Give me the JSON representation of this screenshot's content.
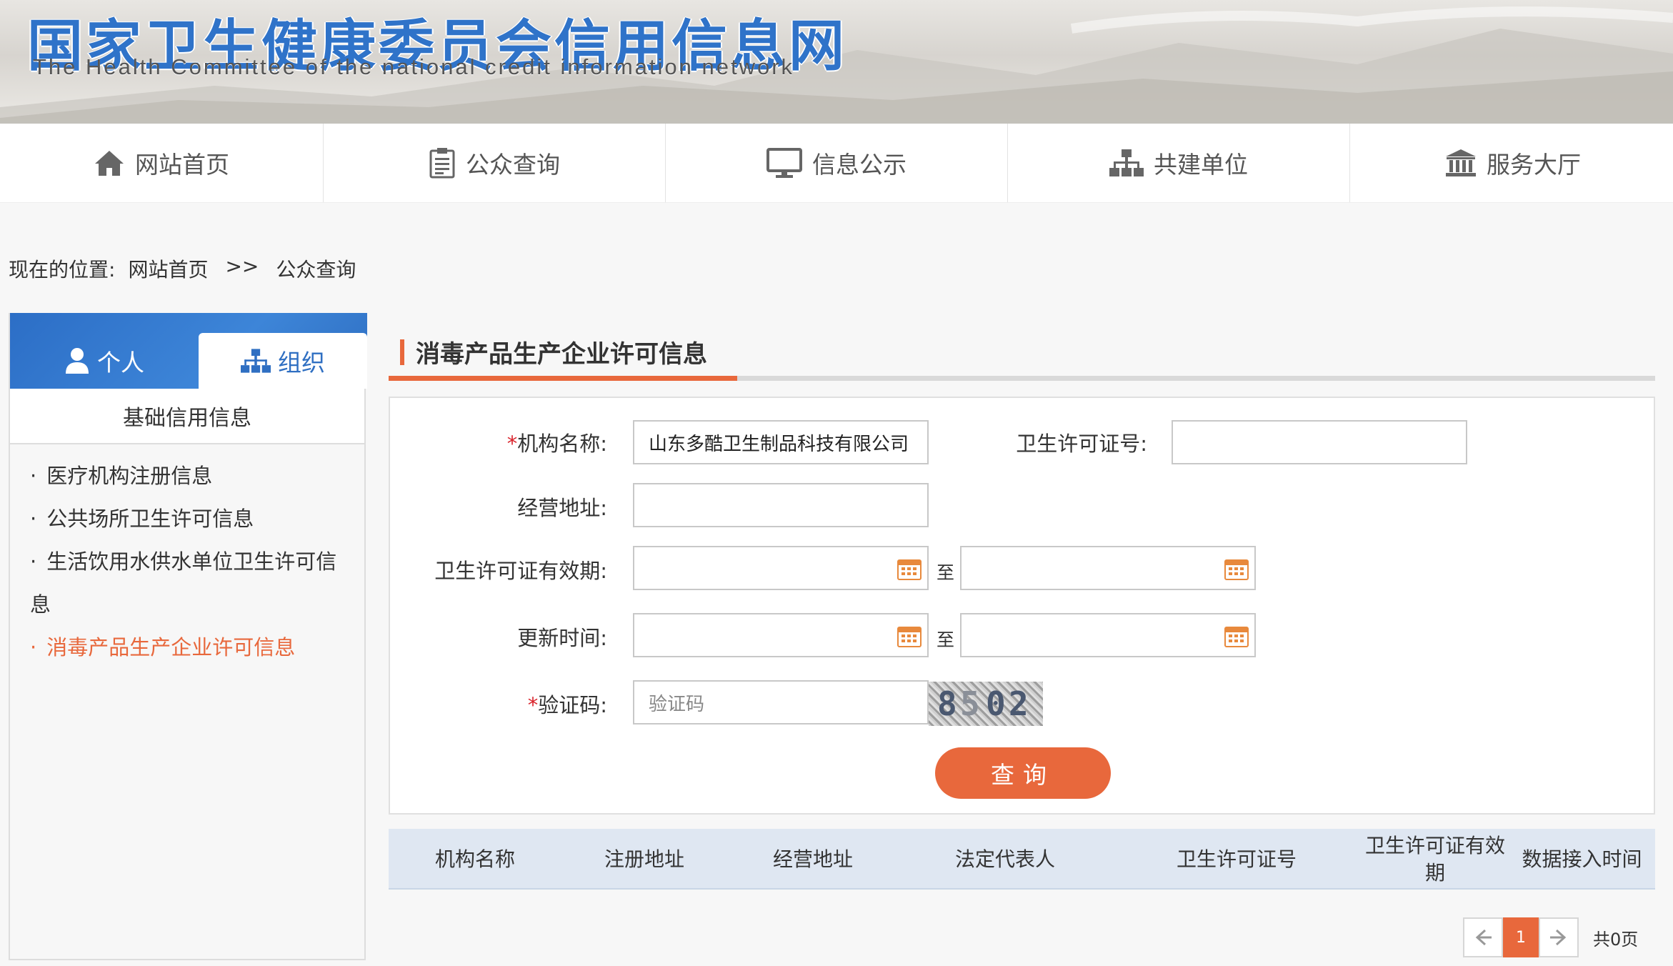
{
  "header": {
    "title": "国家卫生健康委员会信用信息网",
    "subtitle": "The Health Committee of the national credit information network"
  },
  "nav": {
    "items": [
      {
        "label": "网站首页",
        "icon": "home-icon"
      },
      {
        "label": "公众查询",
        "icon": "clipboard-icon"
      },
      {
        "label": "信息公示",
        "icon": "monitor-icon"
      },
      {
        "label": "共建单位",
        "icon": "org-chart-icon"
      },
      {
        "label": "服务大厅",
        "icon": "bank-icon"
      }
    ]
  },
  "breadcrumb": {
    "prefix": "现在的位置:",
    "home": "网站首页",
    "sep": ">>",
    "current": "公众查询"
  },
  "sidebar": {
    "tabs": [
      {
        "label": "个人",
        "icon": "person-icon"
      },
      {
        "label": "组织",
        "icon": "org-chart-icon"
      }
    ],
    "heading": "基础信用信息",
    "items": [
      {
        "label": "医疗机构注册信息"
      },
      {
        "label": "公共场所卫生许可信息"
      },
      {
        "label": "生活饮用水供水单位卫生许可信"
      },
      {
        "label": "息"
      },
      {
        "label": "消毒产品生产企业许可信息",
        "active": true
      }
    ],
    "bullet": "·"
  },
  "main": {
    "title": "消毒产品生产企业许可信息",
    "form": {
      "org_name_label": "机构名称:",
      "org_name_value": "山东多酷卫生制品科技有限公司",
      "license_no_label": "卫生许可证号:",
      "license_no_value": "",
      "address_label": "经营地址:",
      "address_value": "",
      "validity_label": "卫生许可证有效期:",
      "update_label": "更新时间:",
      "to": "至",
      "captcha_label": "验证码:",
      "captcha_placeholder": "验证码",
      "captcha_text": [
        "8",
        "5",
        "0",
        "2"
      ],
      "required_mark": "*",
      "query_button": "查询"
    },
    "table": {
      "columns": [
        "机构名称",
        "注册地址",
        "经营地址",
        "法定代表人",
        "卫生许可证号",
        "卫生许可证有效期",
        "数据接入时间"
      ],
      "rows": []
    },
    "pager": {
      "current": "1",
      "total": "共0页"
    }
  },
  "colors": {
    "accent": "#e8683c",
    "brand_blue": "#2f6fc2",
    "table_header_bg": "#dfe7f2"
  }
}
